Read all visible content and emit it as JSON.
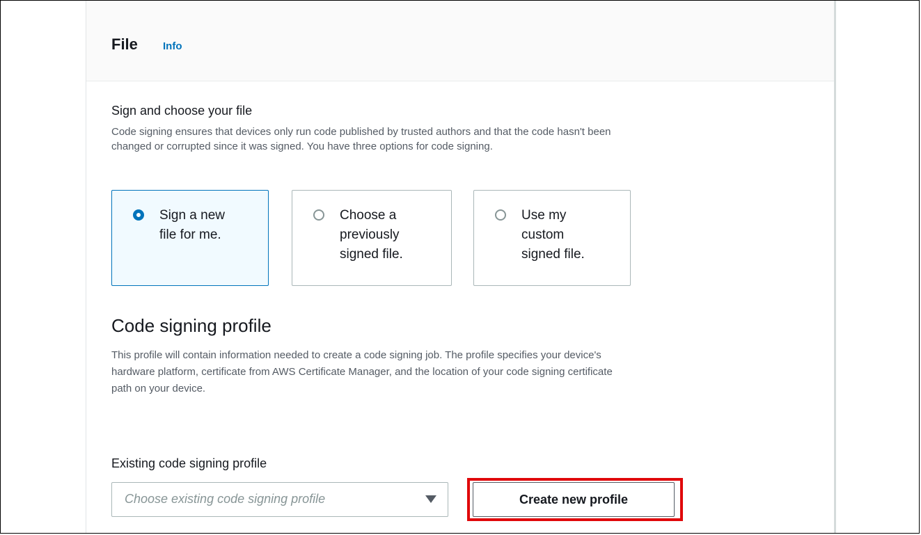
{
  "header": {
    "title": "File",
    "info_link": "Info"
  },
  "sign_section": {
    "title": "Sign and choose your file",
    "description": "Code signing ensures that devices only run code published by trusted authors and that the code hasn't been changed or corrupted since it was signed. You have three options for code signing.",
    "options": [
      {
        "label": "Sign a new file for me.",
        "lines": [
          "Sign a new",
          "file for me."
        ],
        "selected": true
      },
      {
        "label": "Choose a previously signed file.",
        "lines": [
          "Choose a",
          "previously",
          "signed file."
        ],
        "selected": false
      },
      {
        "label": "Use my custom signed file.",
        "lines": [
          "Use my",
          "custom",
          "signed file."
        ],
        "selected": false
      }
    ]
  },
  "profile_section": {
    "title": "Code signing profile",
    "description": "This profile will contain information needed to create a code signing job. The profile specifies your device's hardware platform, certificate from AWS Certificate Manager, and the location of your code signing certificate path on your device.",
    "field_label": "Existing code signing profile",
    "select_placeholder": "Choose existing code signing profile",
    "create_button": "Create new profile"
  },
  "colors": {
    "accent": "#0073bb",
    "highlight": "#e0090b",
    "selected_tile_bg": "#f1faff",
    "text": "#16191f",
    "muted_text": "#545b64"
  },
  "icons": {
    "select_arrow": "caret-down-icon",
    "radio_checked": "radio-checked-icon",
    "radio_unchecked": "radio-unchecked-icon"
  }
}
